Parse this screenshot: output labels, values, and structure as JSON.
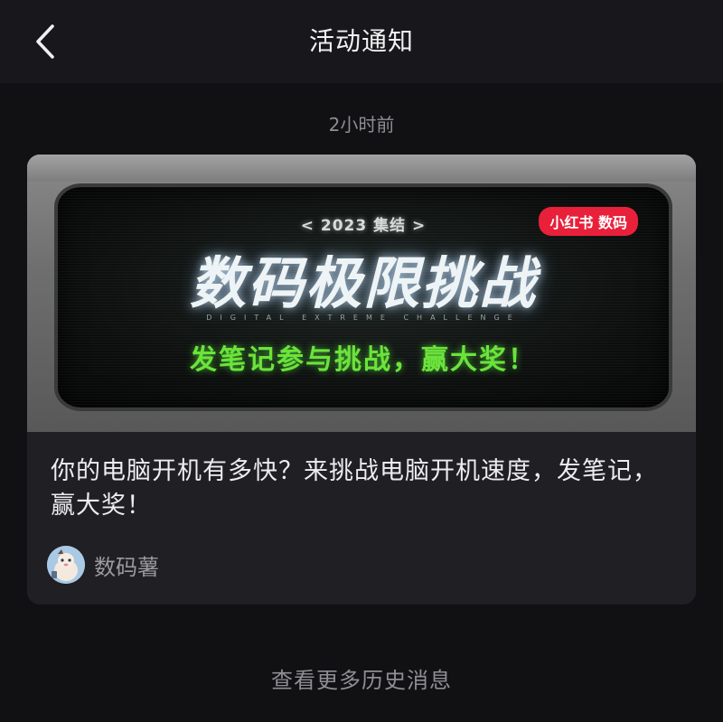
{
  "header": {
    "title": "活动通知",
    "back_icon": "chevron-left-icon"
  },
  "notification": {
    "timestamp": "2小时前",
    "banner": {
      "brand_tag": "小红书 数码",
      "year_tag": "< 2023 集结 >",
      "headline": "数码极限挑战",
      "subline_en": "DIGITAL EXTREME CHALLENGE",
      "slogan": "发笔记参与挑战，赢大奖！",
      "slogan_color": "#6be33b",
      "brand_color": "#e8203a"
    },
    "title": "你的电脑开机有多快？来挑战电脑开机速度，发笔记，赢大奖！",
    "author": {
      "name": "数码薯",
      "avatar_icon": "avatar-icon"
    }
  },
  "footer": {
    "more_label": "查看更多历史消息"
  }
}
